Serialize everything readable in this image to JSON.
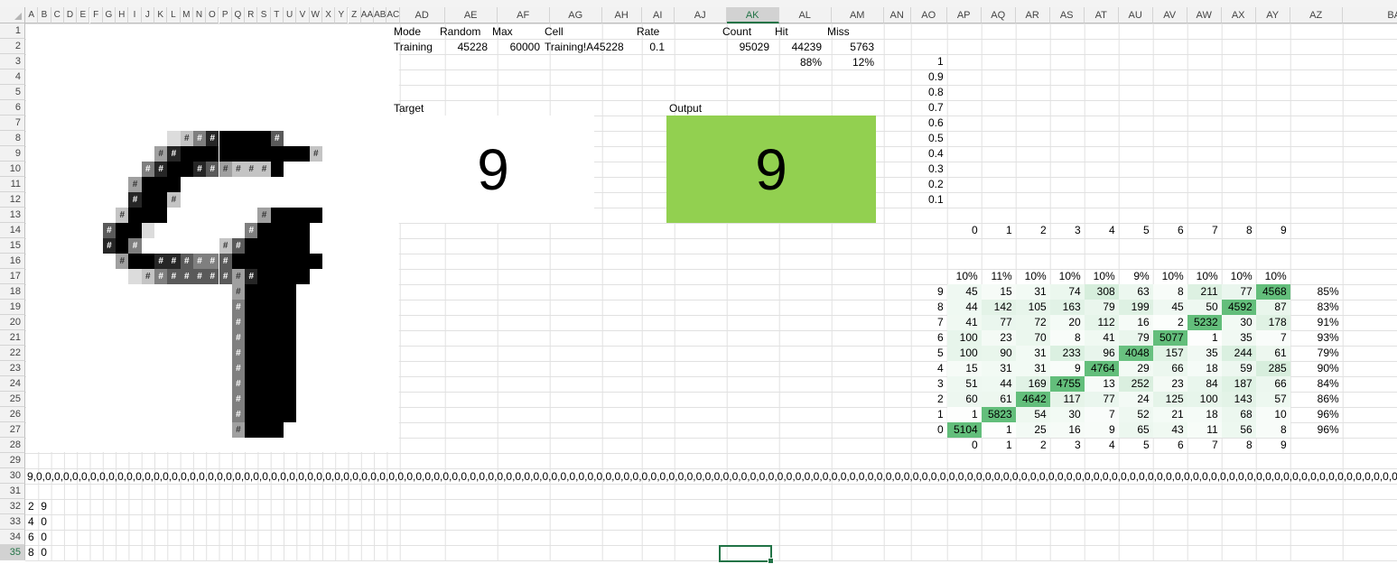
{
  "sheet": {
    "columns": [
      "A",
      "B",
      "C",
      "D",
      "E",
      "F",
      "G",
      "H",
      "I",
      "J",
      "K",
      "L",
      "M",
      "N",
      "O",
      "P",
      "Q",
      "R",
      "S",
      "T",
      "U",
      "V",
      "W",
      "X",
      "Y",
      "Z",
      "AA",
      "AB",
      "AC",
      "AD",
      "AE",
      "AF",
      "AG",
      "AH",
      "AI",
      "AJ",
      "AK",
      "AL",
      "AM",
      "AN",
      "AO",
      "AP",
      "AQ",
      "AR",
      "AS",
      "AT",
      "AU",
      "AV",
      "AW",
      "AX",
      "AY",
      "AZ",
      "BA"
    ],
    "selected_column": "AK",
    "selected_row": "35"
  },
  "stats": {
    "headers": {
      "mode": "Mode",
      "random": "Random",
      "max": "Max",
      "cell": "Cell",
      "rate": "Rate",
      "count": "Count",
      "hit": "Hit",
      "miss": "Miss"
    },
    "values": {
      "mode": "Training",
      "random": "45228",
      "max": "60000",
      "cell": "Training!A45228",
      "rate": "0.1",
      "count": "95029",
      "hit": "44239",
      "miss": "5763"
    },
    "hit_pct": "88%",
    "miss_pct": "12%"
  },
  "target": {
    "label": "Target",
    "value": "9"
  },
  "output": {
    "label": "Output",
    "value": "9",
    "color": "#92d050"
  },
  "scale": [
    "1",
    "0.9",
    "0.8",
    "0.7",
    "0.6",
    "0.5",
    "0.4",
    "0.3",
    "0.2",
    "0.1"
  ],
  "top_digits": [
    "0",
    "1",
    "2",
    "3",
    "4",
    "5",
    "6",
    "7",
    "8",
    "9"
  ],
  "col_pcts": [
    "10%",
    "11%",
    "10%",
    "10%",
    "10%",
    "9%",
    "10%",
    "10%",
    "10%",
    "10%"
  ],
  "confusion": {
    "rows": [
      {
        "label": "9",
        "values": [
          "45",
          "15",
          "31",
          "74",
          "308",
          "63",
          "8",
          "211",
          "77",
          "4568"
        ],
        "acc": "85%"
      },
      {
        "label": "8",
        "values": [
          "44",
          "142",
          "105",
          "163",
          "79",
          "199",
          "45",
          "50",
          "4592",
          "87"
        ],
        "acc": "83%"
      },
      {
        "label": "7",
        "values": [
          "41",
          "77",
          "72",
          "20",
          "112",
          "16",
          "2",
          "5232",
          "30",
          "178"
        ],
        "acc": "91%"
      },
      {
        "label": "6",
        "values": [
          "100",
          "23",
          "70",
          "8",
          "41",
          "79",
          "5077",
          "1",
          "35",
          "7"
        ],
        "acc": "93%"
      },
      {
        "label": "5",
        "values": [
          "100",
          "90",
          "31",
          "233",
          "96",
          "4048",
          "157",
          "35",
          "244",
          "61"
        ],
        "acc": "79%"
      },
      {
        "label": "4",
        "values": [
          "15",
          "31",
          "31",
          "9",
          "4764",
          "29",
          "66",
          "18",
          "59",
          "285"
        ],
        "acc": "90%"
      },
      {
        "label": "3",
        "values": [
          "51",
          "44",
          "169",
          "4755",
          "13",
          "252",
          "23",
          "84",
          "187",
          "66"
        ],
        "acc": "84%"
      },
      {
        "label": "2",
        "values": [
          "60",
          "61",
          "4642",
          "117",
          "77",
          "24",
          "125",
          "100",
          "143",
          "57"
        ],
        "acc": "86%"
      },
      {
        "label": "1",
        "values": [
          "1",
          "5823",
          "54",
          "30",
          "7",
          "52",
          "21",
          "18",
          "68",
          "10"
        ],
        "acc": "96%"
      },
      {
        "label": "0",
        "values": [
          "5104",
          "1",
          "25",
          "16",
          "9",
          "65",
          "43",
          "11",
          "56",
          "8"
        ],
        "acc": "96%"
      }
    ],
    "bottom_labels": [
      "0",
      "1",
      "2",
      "3",
      "4",
      "5",
      "6",
      "7",
      "8",
      "9"
    ]
  },
  "row30_text": "9,0,0,0,0,0,0,0,0,0,0,0,0,0,0,0,0,0,0,0,0,0,0,0,0,0,0,0,0,0,0,0,0,0,0,0,0,0,0,0,0,0,0,0,0,0,0,0,0,0,0,0,0,0,0,0,0,0,0,0,0,0,0,0,0,0,0,0,0,0,0,0,0,0,0,0,0,0,0,0,0,0,0,0,0,0,0,0,0,0,0,0,0,0,0,0,0,0,0,0,0,0,0,0,0,0,0,0,0,0,0,0,0,0,0,0,0,0,0,0,0,0,0,0,0,0,0,0,0,0,0,0,0,0,0,0,0,0,0,0,0,0,0,0,0,0,0,0,0,0,0,0,0,0,0,0,0,0,0,0,0,0,0,0,0,0,0,0,0,0,0,0,0,0,0,0,0,0,0,0,0,0,0,0,0,0,0,0,0,0,0,0,0,0,0,0,0,0,0,0,0,0,0,0,0,0,0,0,0,0,0,0,0,0,0,0,0,0,0,0,0,0,0,0,0,0,0,0,0,0,0,0,0,0,0,0,0,0,0,0,0,0,0,0,0,0,0,0,0,0,0,0,0,0,0,0,0,0,0,0,0,0,0,0,0,0,0,0,0,0,0,0,0,0,0,0,0,0,0,0,0,0",
  "small_table": [
    [
      "2",
      "9"
    ],
    [
      "4",
      "0"
    ],
    [
      "6",
      "0"
    ],
    [
      "8",
      "0"
    ]
  ],
  "pixel_art": {
    "glyph": "#",
    "rows": [
      "..............................",
      "..............................",
      "..............................",
      "..............................",
      "..............................",
      "..............................",
      "..............................",
      "...........346899997..........",
      "..........5899999999994.......",
      ".........68998754442..........",
      "........5999..................",
      "........8994...................",
      ".......4999.......59999........",
      "......7993.......69999.........",
      "......896......4799999.........",
      ".......5998876679999999........",
      "........34677777589999.........",
      "................59999..........",
      "................69999..........",
      "................69999..........",
      "................69999..........",
      "................69999..........",
      "................69999..........",
      "................69999..........",
      "................69999..........",
      "................69999..........",
      "................5999..........."
    ]
  }
}
